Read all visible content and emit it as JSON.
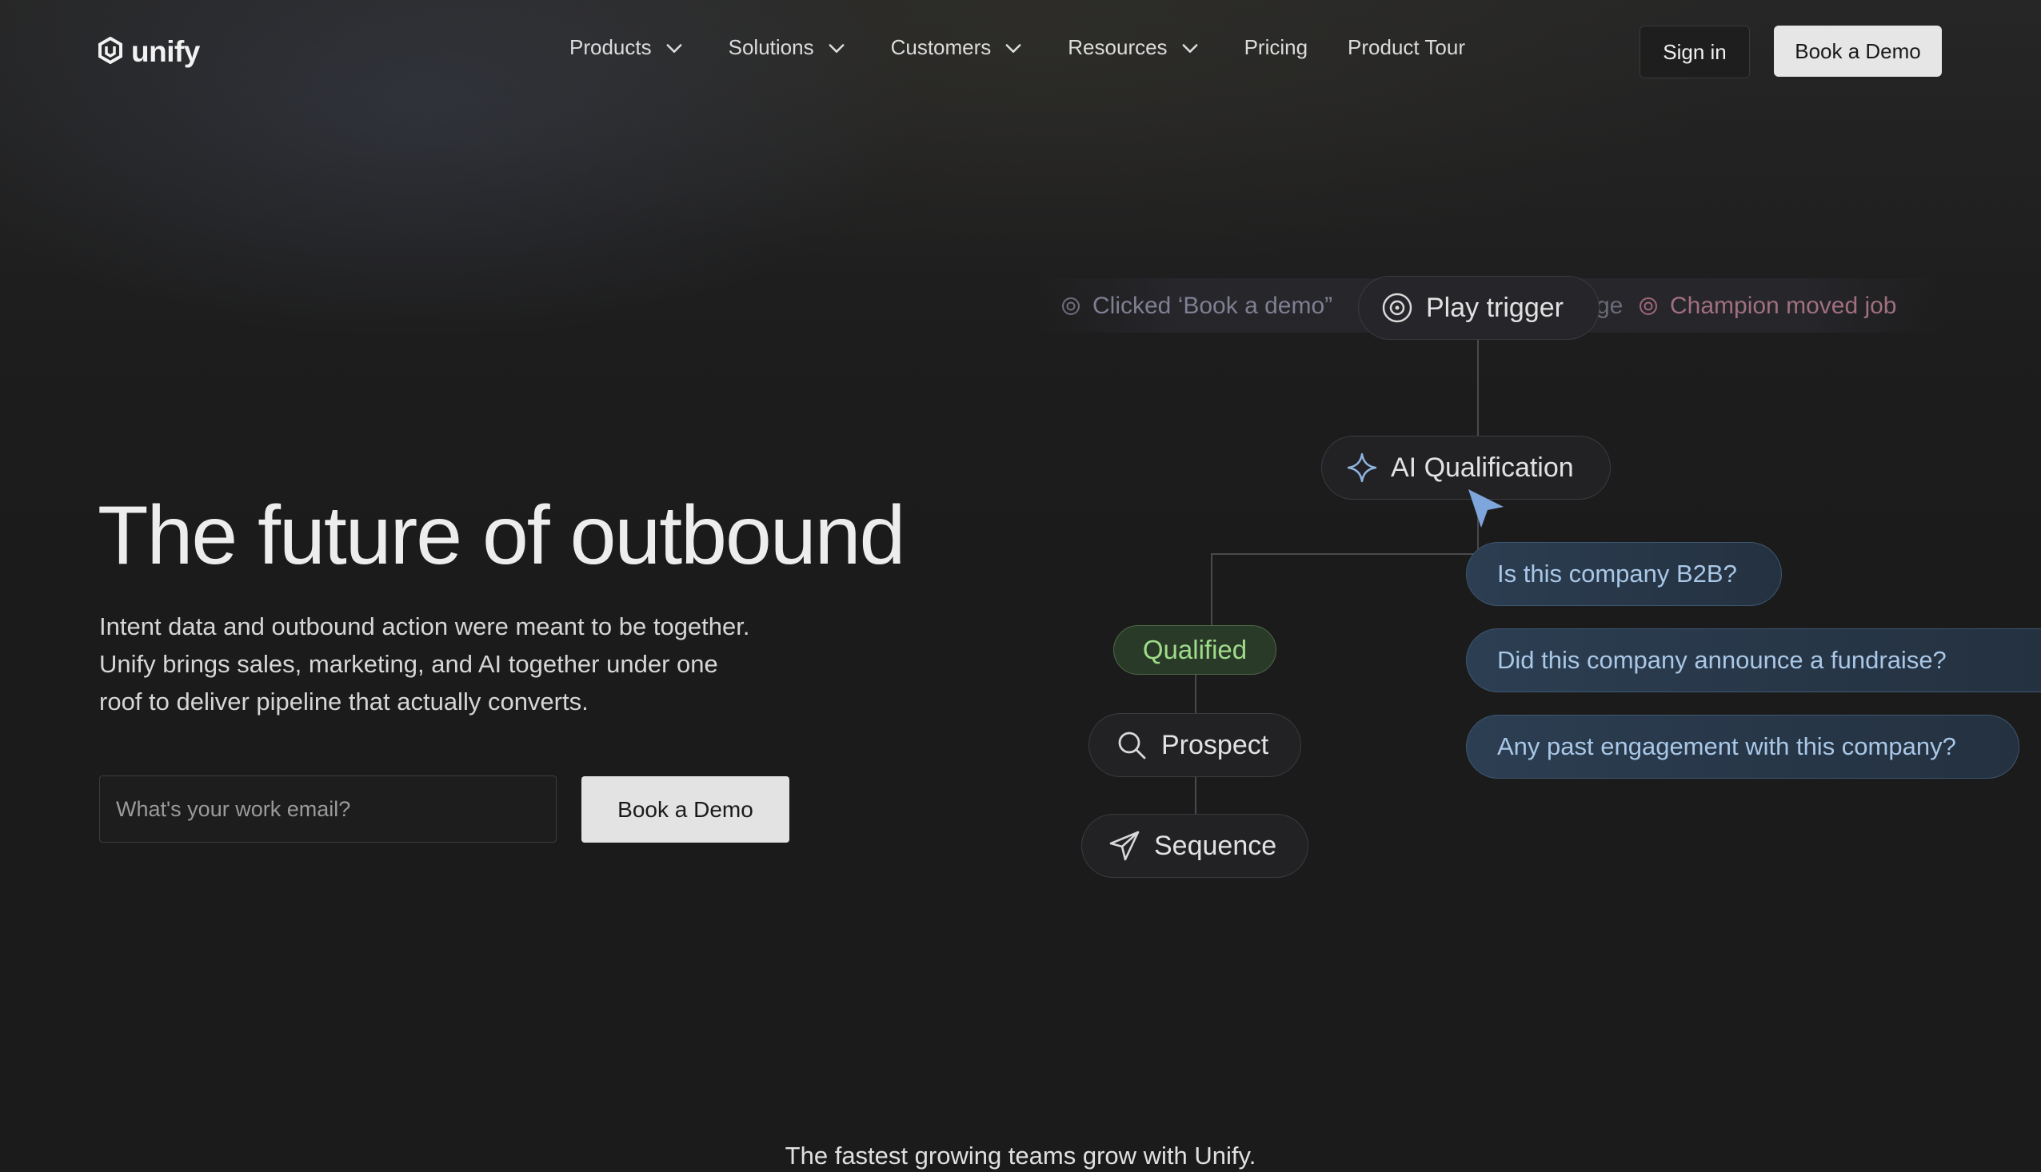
{
  "brand": {
    "name": "unify"
  },
  "nav": {
    "items": [
      {
        "label": "Products",
        "has_dropdown": true
      },
      {
        "label": "Solutions",
        "has_dropdown": true
      },
      {
        "label": "Customers",
        "has_dropdown": true
      },
      {
        "label": "Resources",
        "has_dropdown": true
      },
      {
        "label": "Pricing",
        "has_dropdown": false
      },
      {
        "label": "Product Tour",
        "has_dropdown": false
      }
    ],
    "sign_in": "Sign in",
    "book_demo": "Book a Demo"
  },
  "hero": {
    "title": "The future of outbound",
    "subtitle": "Intent data and outbound action were meant to be together. Unify brings sales, marketing, and AI together under one roof to deliver pipeline that actually converts.",
    "email_placeholder": "What's your work email?",
    "email_value": "",
    "cta": "Book a Demo"
  },
  "diagram": {
    "trigger_strip": {
      "left_event": "Clicked ‘Book a demo”",
      "cut_text": "ge",
      "right_event": "Champion moved job"
    },
    "play_trigger": "Play trigger",
    "ai_qualification": "AI Qualification",
    "qualified": "Qualified",
    "prospect": "Prospect",
    "sequence": "Sequence",
    "questions": [
      "Is this company B2B?",
      "Did this company announce a fundraise?",
      "Any past engagement with this company?"
    ],
    "colors": {
      "qualified_text": "#9fdc8a",
      "question_text": "#a9c7e6",
      "cursor": "#7ea6dc"
    }
  },
  "footer_tagline": "The fastest growing teams grow with Unify."
}
